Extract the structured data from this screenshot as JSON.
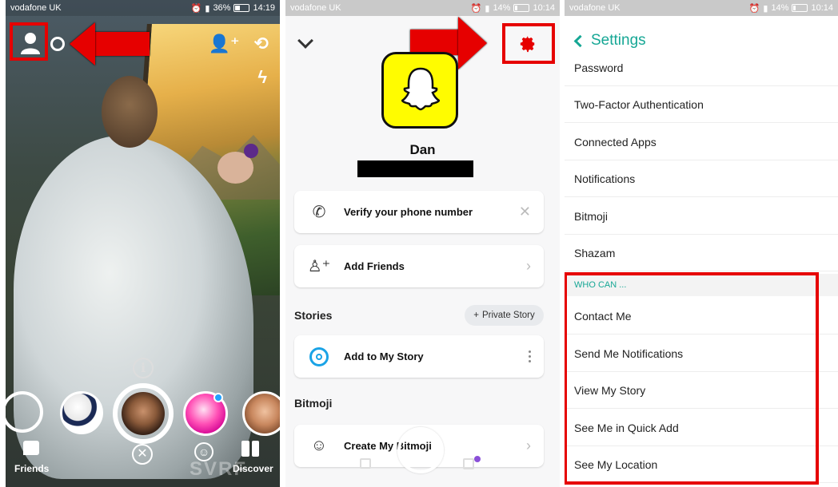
{
  "status": {
    "p1": {
      "carrier": "vodafone UK",
      "battery": "36%",
      "time": "14:19"
    },
    "p2": {
      "carrier": "vodafone UK",
      "battery": "14%",
      "time": "10:14"
    },
    "p3": {
      "carrier": "vodafone UK",
      "battery": "14%",
      "time": "10:14"
    }
  },
  "camera": {
    "friends_label": "Friends",
    "discover_label": "Discover",
    "watermark": "SVRF"
  },
  "profile": {
    "display_name": "Dan",
    "cards": {
      "verify": "Verify your phone number",
      "add_friends": "Add Friends",
      "add_story": "Add to My Story",
      "bitmoji": "Create My Bitmoji"
    },
    "sections": {
      "stories": "Stories",
      "bitmoji": "Bitmoji"
    },
    "private_story": "Private Story"
  },
  "settings": {
    "title": "Settings",
    "items_top": [
      "Password",
      "Two-Factor Authentication",
      "Connected Apps",
      "Notifications",
      "Bitmoji",
      "Shazam"
    ],
    "who_header": "WHO CAN ...",
    "items_who": [
      "Contact Me",
      "Send Me Notifications",
      "View My Story",
      "See Me in Quick Add",
      "See My Location"
    ]
  },
  "colors": {
    "accent": "#16a795",
    "highlight": "#e60000",
    "snap_yellow": "#fffc00"
  }
}
